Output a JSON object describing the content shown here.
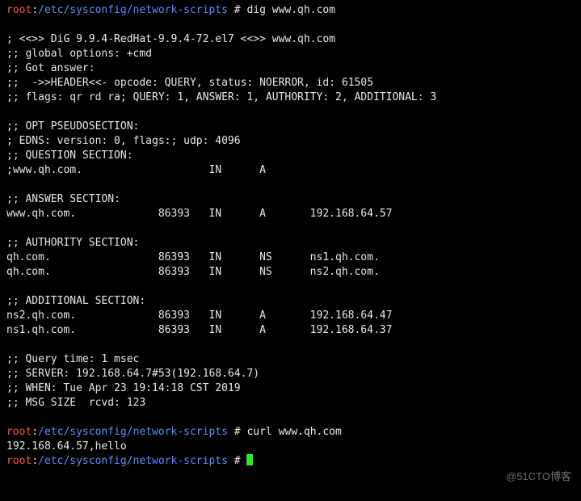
{
  "prompt": {
    "user": "root",
    "sep": ":",
    "path": "/etc/sysconfig/network-scripts",
    "hash": " # "
  },
  "cmd": {
    "dig": "dig www.qh.com",
    "curl": "curl www.qh.com",
    "idle": ""
  },
  "l": {
    "blank": "",
    "hdr1": "; <<>> DiG 9.9.4-RedHat-9.9.4-72.el7 <<>> www.qh.com",
    "hdr2": ";; global options: +cmd",
    "hdr3": ";; Got answer:",
    "hdr4": ";;  ->>HEADER<<- opcode: QUERY, status: NOERROR, id: 61505",
    "hdr5": ";; flags: qr rd ra; QUERY: 1, ANSWER: 1, AUTHORITY: 2, ADDITIONAL: 3",
    "opt1": ";; OPT PSEUDOSECTION:",
    "opt2": "; EDNS: version: 0, flags:; udp: 4096",
    "qs1": ";; QUESTION SECTION:",
    "qs2": ";www.qh.com.                    IN      A",
    "ans1": ";; ANSWER SECTION:",
    "ans2": "www.qh.com.             86393   IN      A       192.168.64.57",
    "auth1": ";; AUTHORITY SECTION:",
    "auth2": "qh.com.                 86393   IN      NS      ns1.qh.com.",
    "auth3": "qh.com.                 86393   IN      NS      ns2.qh.com.",
    "add1": ";; ADDITIONAL SECTION:",
    "add2": "ns2.qh.com.             86393   IN      A       192.168.64.47",
    "add3": "ns1.qh.com.             86393   IN      A       192.168.64.37",
    "ft1": ";; Query time: 1 msec",
    "ft2": ";; SERVER: 192.168.64.7#53(192.168.64.7)",
    "ft3": ";; WHEN: Tue Apr 23 19:14:18 CST 2019",
    "ft4": ";; MSG SIZE  rcvd: 123",
    "curlout": "192.168.64.57,hello"
  },
  "watermark": "@51CTO博客"
}
